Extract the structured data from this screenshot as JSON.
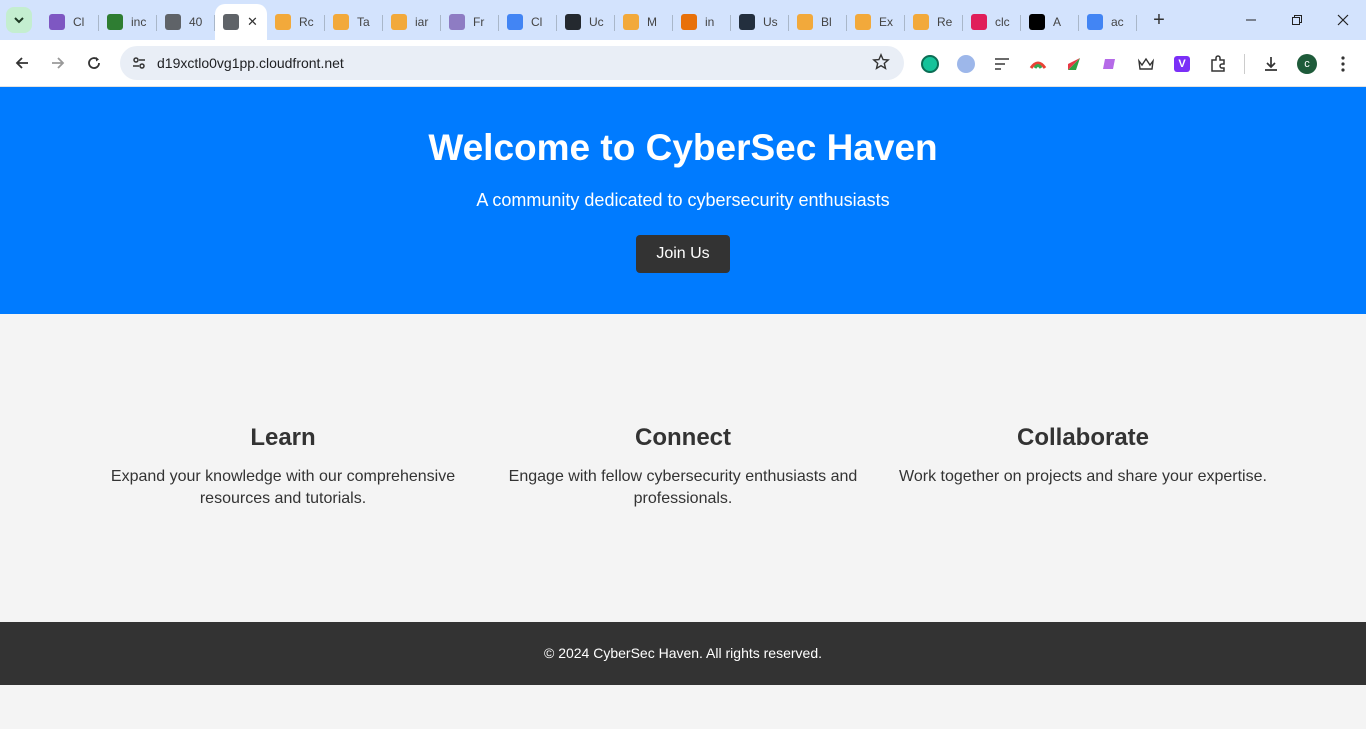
{
  "browser": {
    "tabs": [
      {
        "title": "Cl",
        "color": "#7e57c2"
      },
      {
        "title": "inc",
        "color": "#2e7d32"
      },
      {
        "title": "40",
        "color": "#5f6368"
      },
      {
        "title": "",
        "color": "#5f6368",
        "active": true
      },
      {
        "title": "Rc",
        "color": "#f2a93b"
      },
      {
        "title": "Ta",
        "color": "#f2a93b"
      },
      {
        "title": "iar",
        "color": "#f2a93b"
      },
      {
        "title": "Fr",
        "color": "#8e7cc3"
      },
      {
        "title": "Cl",
        "color": "#4285f4"
      },
      {
        "title": "Uc",
        "color": "#24292f"
      },
      {
        "title": "M",
        "color": "#f2a93b"
      },
      {
        "title": "in",
        "color": "#e8710a"
      },
      {
        "title": "Us",
        "color": "#232f3e"
      },
      {
        "title": "Bl",
        "color": "#f2a93b"
      },
      {
        "title": "Ex",
        "color": "#f2a93b"
      },
      {
        "title": "Re",
        "color": "#f2a93b"
      },
      {
        "title": "clc",
        "color": "#e01e5a"
      },
      {
        "title": "A",
        "color": "#000000"
      },
      {
        "title": "ac",
        "color": "#4285f4"
      }
    ],
    "active_tab_close": "✕",
    "new_tab": "+",
    "url": "d19xctlo0vg1pp.cloudfront.net",
    "profile_initial": "c"
  },
  "hero": {
    "title": "Welcome to CyberSec Haven",
    "subtitle": "A community dedicated to cybersecurity enthusiasts",
    "cta": "Join Us"
  },
  "features": [
    {
      "title": "Learn",
      "text": "Expand your knowledge with our comprehensive resources and tutorials."
    },
    {
      "title": "Connect",
      "text": "Engage with fellow cybersecurity enthusiasts and professionals."
    },
    {
      "title": "Collaborate",
      "text": "Work together on projects and share your expertise."
    }
  ],
  "footer": {
    "text": "© 2024 CyberSec Haven. All rights reserved."
  },
  "colors": {
    "hero_bg": "#007bff",
    "button_bg": "#333333",
    "footer_bg": "#333333",
    "page_bg": "#f4f4f4"
  }
}
